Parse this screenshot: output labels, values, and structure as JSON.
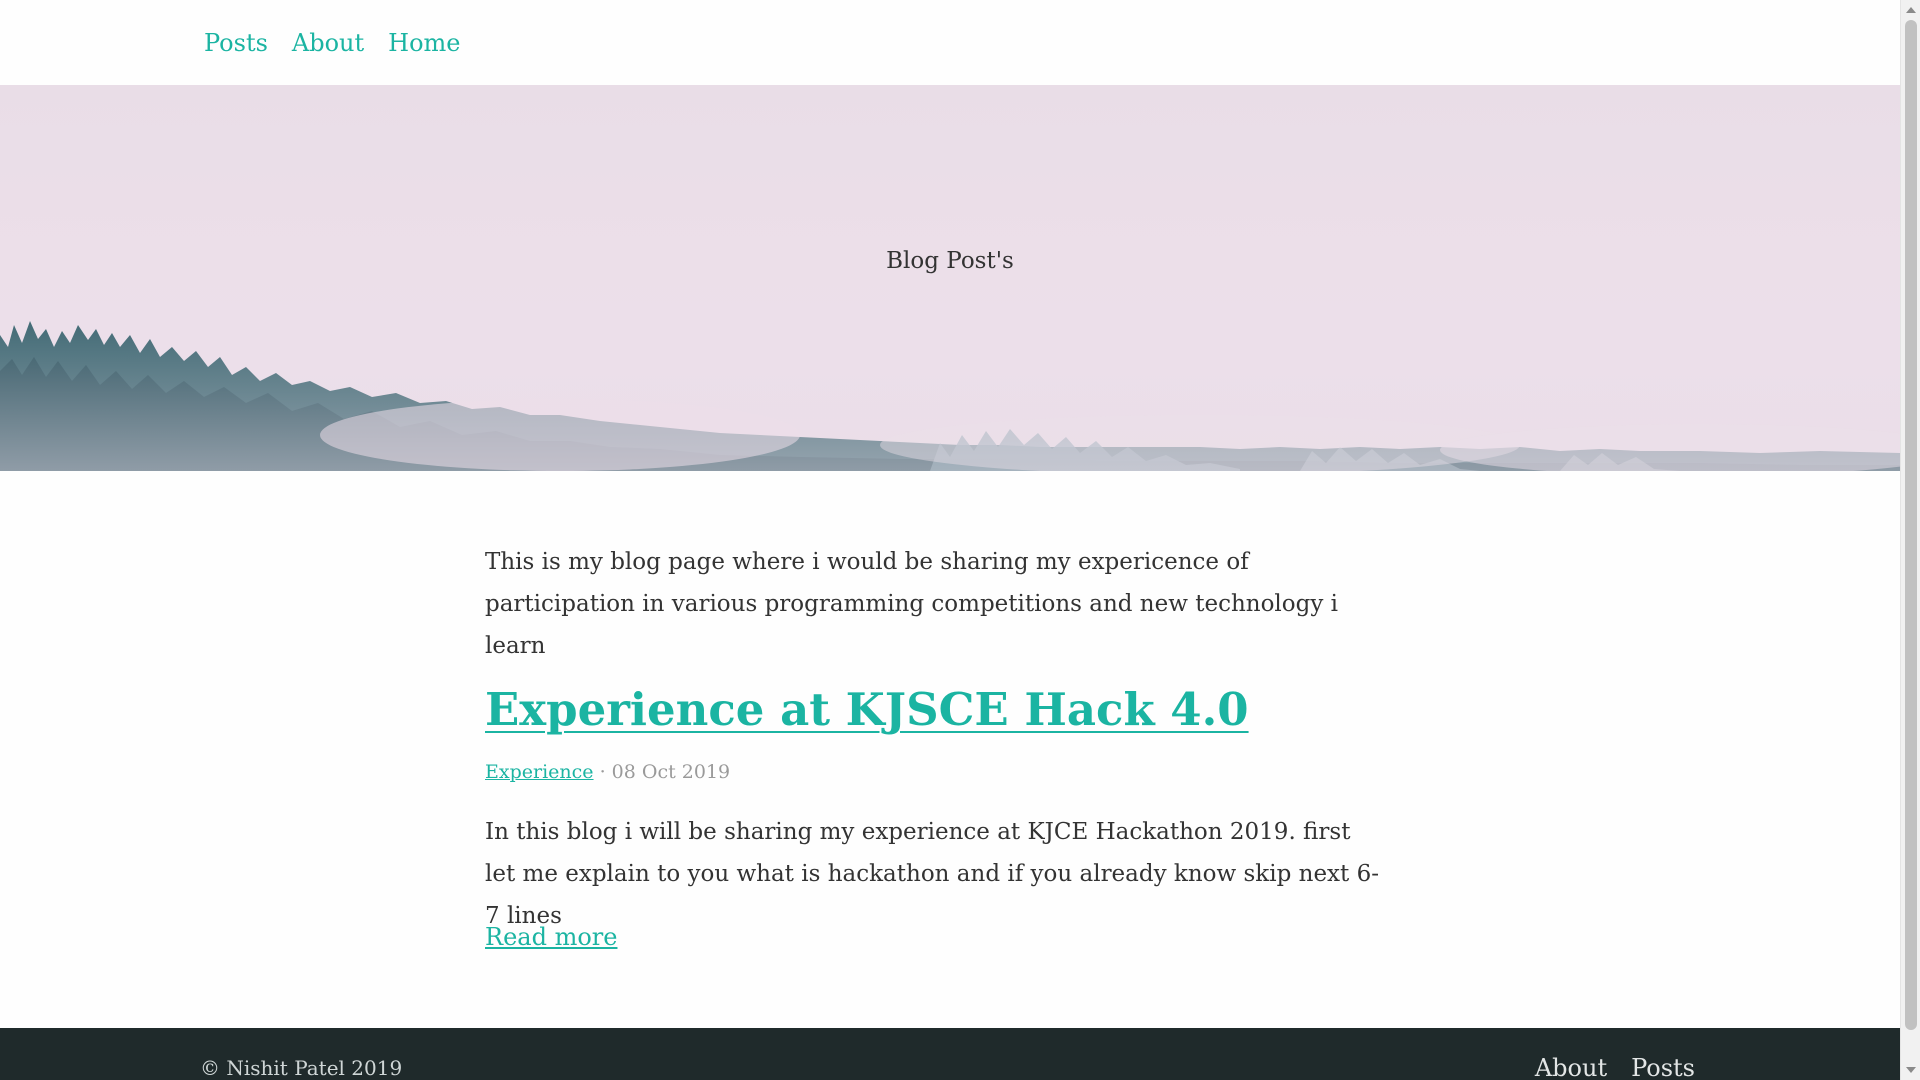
{
  "nav": {
    "items": [
      {
        "label": "Posts"
      },
      {
        "label": "About"
      },
      {
        "label": "Home"
      }
    ]
  },
  "hero": {
    "title": "Blog Post's"
  },
  "main": {
    "intro": "This is my blog page where i would be sharing my expericence of participation in various programming competitions and new technology i learn",
    "posts": [
      {
        "title": "Experience at KJSCE Hack 4.0",
        "tag": "Experience",
        "date": "· 08 Oct 2019",
        "excerpt": "In this blog i will be sharing my experience at KJCE Hackathon 2019. first let me explain to you what is hackathon and if you already know skip next 6-7 lines",
        "read_more": "Read more"
      }
    ]
  },
  "footer": {
    "copyright": "© Nishit Patel 2019",
    "links": [
      {
        "label": "About"
      },
      {
        "label": "Posts"
      }
    ]
  },
  "colors": {
    "accent": "#1bb4a2",
    "text": "#333333",
    "footer_bg": "#1f2a2b",
    "hero_bg": "#ecdfe9"
  }
}
